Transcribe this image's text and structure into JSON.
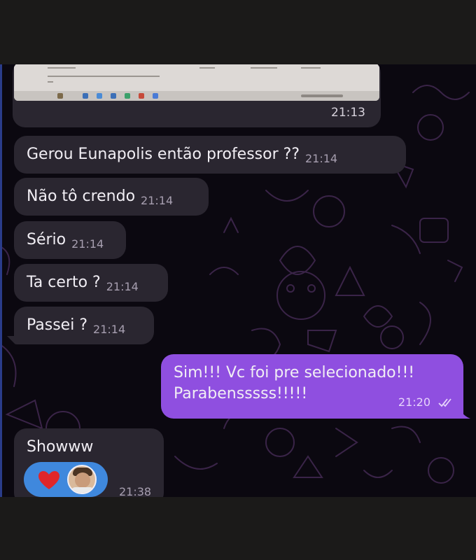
{
  "image_message": {
    "time": "21:13"
  },
  "messages": [
    {
      "text": "Gerou Eunapolis então professor ??",
      "time": "21:14"
    },
    {
      "text": "Não tô crendo",
      "time": "21:14"
    },
    {
      "text": "Sério",
      "time": "21:14"
    },
    {
      "text": "Ta certo ?",
      "time": "21:14"
    },
    {
      "text": "Passei ?",
      "time": "21:14"
    }
  ],
  "outgoing": {
    "line1": "Sim!!! Vc foi pre selecionado!!!",
    "line2": "Parabensssss!!!!!",
    "time": "21:20",
    "status_icon": "double-check-icon"
  },
  "last_message": {
    "text": "Showww",
    "time": "21:38",
    "reaction": "heart-icon"
  },
  "colors": {
    "incoming_bubble": "#2a2630",
    "outgoing_bubble": "#8f4fe0",
    "reaction_bg": "#3f88dd",
    "wallpaper": "#0b0810"
  }
}
